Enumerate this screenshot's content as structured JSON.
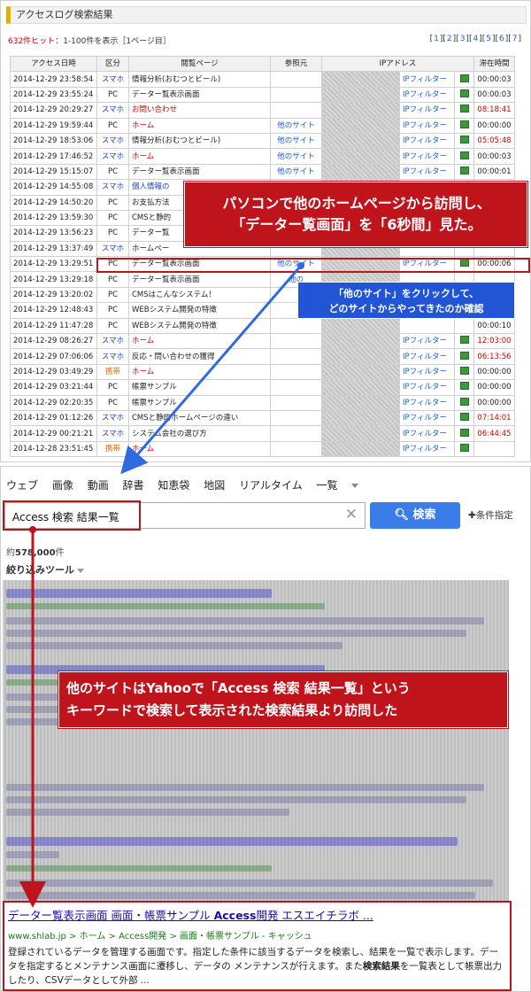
{
  "top": {
    "panel_title": "アクセスログ検索結果",
    "hits_count": "632件ヒット",
    "hits_rest": "：1-100件を表示［1ページ目］",
    "pages": [
      "1",
      "2",
      "3",
      "4",
      "5",
      "6",
      "7"
    ],
    "headers": [
      "アクセス日時",
      "区分",
      "閲覧ページ",
      "参照元",
      "IPアドレス",
      "滞在時間"
    ],
    "rows": [
      {
        "date": "2014-12-29 23:58:54",
        "cat": "スマホ",
        "cat_color": "blue",
        "page": "情報分析(おむつとビール)",
        "page_color": "",
        "ref": "",
        "filter": "IPフィルター",
        "dur": "00:00:03",
        "dur_color": ""
      },
      {
        "date": "2014-12-29 23:55:24",
        "cat": "PC",
        "cat_color": "",
        "page": "データー覧表示画面",
        "page_color": "",
        "ref": "",
        "filter": "IPフィルター",
        "dur": "00:00:03",
        "dur_color": ""
      },
      {
        "date": "2014-12-29 20:29:27",
        "cat": "スマホ",
        "cat_color": "blue",
        "page": "お問い合わせ",
        "page_color": "red",
        "ref": "",
        "filter": "IPフィルター",
        "dur": "08:18:41",
        "dur_color": "red"
      },
      {
        "date": "2014-12-29 19:59:44",
        "cat": "PC",
        "cat_color": "",
        "page": "ホーム",
        "page_color": "red",
        "ref": "他のサイト",
        "filter": "IPフィルター",
        "dur": "00:00:00",
        "dur_color": ""
      },
      {
        "date": "2014-12-29 18:53:06",
        "cat": "スマホ",
        "cat_color": "blue",
        "page": "情報分析(おむつとビール)",
        "page_color": "",
        "ref": "他のサイト",
        "filter": "IPフィルター",
        "dur": "05:05:48",
        "dur_color": "red"
      },
      {
        "date": "2014-12-29 17:46:52",
        "cat": "スマホ",
        "cat_color": "blue",
        "page": "ホーム",
        "page_color": "red",
        "ref": "他のサイト",
        "filter": "IPフィルター",
        "dur": "00:00:03",
        "dur_color": ""
      },
      {
        "date": "2014-12-29 15:15:07",
        "cat": "PC",
        "cat_color": "",
        "page": "データー覧表示画面",
        "page_color": "",
        "ref": "他のサイト",
        "filter": "IPフィルター",
        "dur": "00:00:01",
        "dur_color": ""
      },
      {
        "date": "2014-12-29 14:55:08",
        "cat": "スマホ",
        "cat_color": "blue",
        "page": "個人情報の",
        "page_color": "blue",
        "ref": "",
        "filter": "",
        "dur": "",
        "dur_color": ""
      },
      {
        "date": "2014-12-29 14:50:20",
        "cat": "PC",
        "cat_color": "",
        "page": "お支払方法",
        "page_color": "",
        "ref": "",
        "filter": "",
        "dur": "",
        "dur_color": ""
      },
      {
        "date": "2014-12-29 13:59:30",
        "cat": "PC",
        "cat_color": "",
        "page": "CMSと静的",
        "page_color": "",
        "ref": "",
        "filter": "",
        "dur": "",
        "dur_color": ""
      },
      {
        "date": "2014-12-29 13:56:23",
        "cat": "PC",
        "cat_color": "",
        "page": "データー覧",
        "page_color": "",
        "ref": "",
        "filter": "",
        "dur": "",
        "dur_color": ""
      },
      {
        "date": "2014-12-29 13:37:49",
        "cat": "スマホ",
        "cat_color": "blue",
        "page": "ホームペー",
        "page_color": "",
        "ref": "",
        "filter": "",
        "dur": "",
        "dur_color": ""
      },
      {
        "date": "2014-12-29 13:29:51",
        "cat": "PC",
        "cat_color": "",
        "page": "データー覧表示画面",
        "page_color": "",
        "ref": "他のサイト",
        "filter": "IPフィルター",
        "dur": "00:00:06",
        "dur_color": ""
      },
      {
        "date": "2014-12-29 13:29:18",
        "cat": "PC",
        "cat_color": "",
        "page": "データー覧表示画面",
        "page_color": "",
        "ref": "他の",
        "filter": "",
        "dur": "",
        "dur_color": ""
      },
      {
        "date": "2014-12-29 13:20:02",
        "cat": "PC",
        "cat_color": "",
        "page": "CMSはこんなシステム！",
        "page_color": "",
        "ref": "",
        "filter": "",
        "dur": "",
        "dur_color": ""
      },
      {
        "date": "2014-12-29 12:48:43",
        "cat": "PC",
        "cat_color": "",
        "page": "WEBシステム開発の特徴",
        "page_color": "",
        "ref": "",
        "filter": "",
        "dur": "",
        "dur_color": ""
      },
      {
        "date": "2014-12-29 11:47:28",
        "cat": "PC",
        "cat_color": "",
        "page": "WEBシステム開発の特徴",
        "page_color": "",
        "ref": "",
        "filter": "",
        "dur": "00:00:10",
        "dur_color": ""
      },
      {
        "date": "2014-12-29 08:26:27",
        "cat": "スマホ",
        "cat_color": "blue",
        "page": "ホーム",
        "page_color": "red",
        "ref": "",
        "filter": "IPフィルター",
        "dur": "12:03:00",
        "dur_color": "red"
      },
      {
        "date": "2014-12-29 07:06:06",
        "cat": "スマホ",
        "cat_color": "blue",
        "page": "反応・問い合わせの獲得",
        "page_color": "",
        "ref": "",
        "filter": "IPフィルター",
        "dur": "06:13:56",
        "dur_color": "red"
      },
      {
        "date": "2014-12-29 03:49:29",
        "cat": "携帯",
        "cat_color": "orange",
        "page": "ホーム",
        "page_color": "red",
        "ref": "",
        "filter": "IPフィルター",
        "dur": "00:00:00",
        "dur_color": ""
      },
      {
        "date": "2014-12-29 03:21:44",
        "cat": "PC",
        "cat_color": "",
        "page": "帳票サンプル",
        "page_color": "",
        "ref": "",
        "filter": "IPフィルター",
        "dur": "00:00:00",
        "dur_color": ""
      },
      {
        "date": "2014-12-29 02:20:35",
        "cat": "PC",
        "cat_color": "",
        "page": "帳票サンプル",
        "page_color": "",
        "ref": "",
        "filter": "IPフィルター",
        "dur": "00:00:00",
        "dur_color": ""
      },
      {
        "date": "2014-12-29 01:12:26",
        "cat": "スマホ",
        "cat_color": "blue",
        "page": "CMSと静的ホームページの違い",
        "page_color": "",
        "ref": "",
        "filter": "IPフィルター",
        "dur": "07:14:01",
        "dur_color": "red"
      },
      {
        "date": "2014-12-29 00:21:21",
        "cat": "スマホ",
        "cat_color": "blue",
        "page": "システム会社の選び方",
        "page_color": "",
        "ref": "",
        "filter": "IPフィルター",
        "dur": "06:44:45",
        "dur_color": "red"
      },
      {
        "date": "2014-12-28 23:51:45",
        "cat": "携帯",
        "cat_color": "orange",
        "page": "ホーム",
        "page_color": "red",
        "ref": "",
        "filter": "IPフィルター",
        "dur": "",
        "dur_color": ""
      }
    ],
    "callout1_line1": "パソコンで他のホームページから訪問し、",
    "callout1_line2": "「データー覧画面」を「6秒間」見た。",
    "callout_blue_line1": "「他のサイト」をクリックして、",
    "callout_blue_line2": "どのサイトからやってきたのか確認"
  },
  "bottom": {
    "tabs": [
      "ウェブ",
      "画像",
      "動画",
      "辞書",
      "知恵袋",
      "地図",
      "リアルタイム",
      "一覧"
    ],
    "query": "Access 検索 結果一覧",
    "search_button": "検索",
    "cond_button": "条件指定",
    "count_prefix": "約",
    "count_value": "578,000",
    "count_suffix": "件",
    "filter_tool": "絞り込みツール",
    "callout2_line1": "他のサイトはYahooで「Access 検索 結果一覧」という",
    "callout2_line2": "キーワードで検索して表示された検索結果より訪問した",
    "result": {
      "title_a": "データー覧表示画面 画面・帳票サンプル ",
      "title_b": "Access",
      "title_c": "開発 エスエイチラボ ...",
      "url": "www.shlab.jp > ホーム > Access開発 > 画面・帳票サンプル - キャッシュ",
      "desc_a": "登録されているデータを管理する画面です。指定した条件に該当するデータを検索し、結果を一覧で表示します。データを指定するとメンテナンス画面に遷移し、データの メンテナンスが行えます。また",
      "desc_b": "検索結果",
      "desc_c": "を一覧表として帳票出力したり、CSVデータとして外部 ..."
    }
  },
  "colors": {
    "callout_red": "#c0141c",
    "callout_blue": "#2255d6",
    "search_blue": "#3b7de8"
  }
}
